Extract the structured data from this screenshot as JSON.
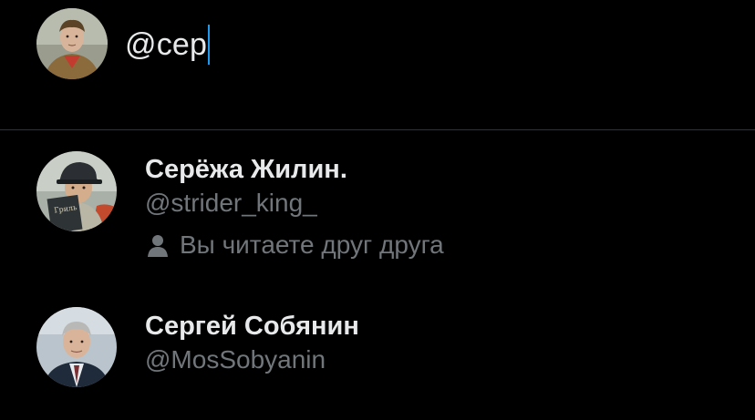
{
  "compose": {
    "input_value": "@сер",
    "caret_color": "#1d9bf0"
  },
  "suggestions": [
    {
      "name": "Серёжа Жилин.",
      "handle": "@strider_king_",
      "relationship": "Вы читаете друг друга",
      "relationship_icon": "person-icon"
    },
    {
      "name": "Сергей Собянин",
      "handle": "@MosSobyanin"
    }
  ],
  "colors": {
    "background": "#000000",
    "primary_text": "#e7e9ea",
    "secondary_text": "#71767b",
    "divider": "#2f3336",
    "accent": "#1d9bf0"
  }
}
